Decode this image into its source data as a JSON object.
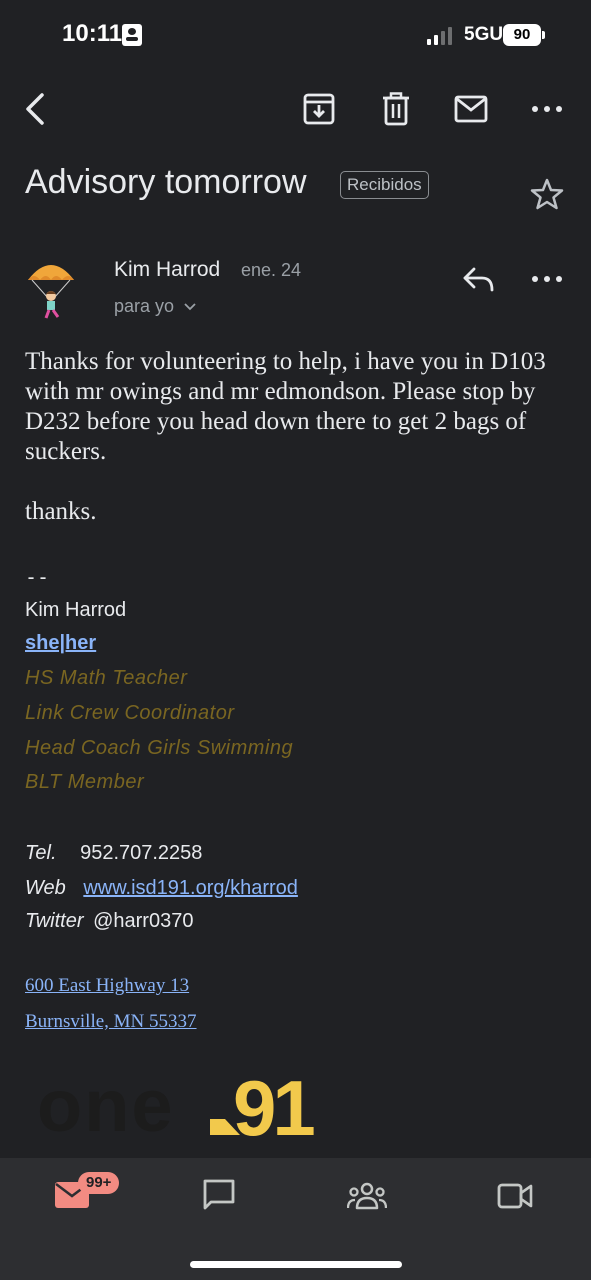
{
  "status_bar": {
    "time": "10:11",
    "network": "5GUC",
    "battery": "90"
  },
  "toolbar": {
    "icons": [
      "back-arrow-icon",
      "archive-icon",
      "trash-icon",
      "mail-icon",
      "more-vert-icon"
    ]
  },
  "email": {
    "subject": "Advisory tomorrow",
    "label": "Recibidos",
    "sender_name": "Kim Harrod",
    "date": "ene. 24",
    "to": "para yo",
    "body": [
      "Thanks for volunteering to help, i have you in D103 with mr owings and mr edmondson. Please stop by D232 before you head down there to get 2 bags of suckers.",
      "thanks."
    ],
    "signature": {
      "separator": "--",
      "name": "Kim Harrod",
      "pronouns": "she|her",
      "titles": [
        "HS Math Teacher",
        "Link Crew Coordinator",
        "Head Coach Girls Swimming",
        "BLT Member"
      ],
      "tel_label": "Tel.",
      "tel": "952.707.2258",
      "web_label": "Web",
      "web": "www.isd191.org/kharrod",
      "twitter_label": "Twitter",
      "twitter": "@harr0370",
      "address_line1": "600 East Highway 13",
      "address_line2": "Burnsville, MN 55337",
      "logo_text": "one91"
    }
  },
  "bottom_nav": {
    "mail_badge": "99+",
    "items": [
      "mail-icon",
      "chat-icon",
      "spaces-icon",
      "meet-icon"
    ]
  },
  "colors": {
    "background": "#202124",
    "gold_text": "#7a6621",
    "link": "#8ab4f8",
    "badge": "#f28b82",
    "logo_yellow": "#f2c94c"
  }
}
